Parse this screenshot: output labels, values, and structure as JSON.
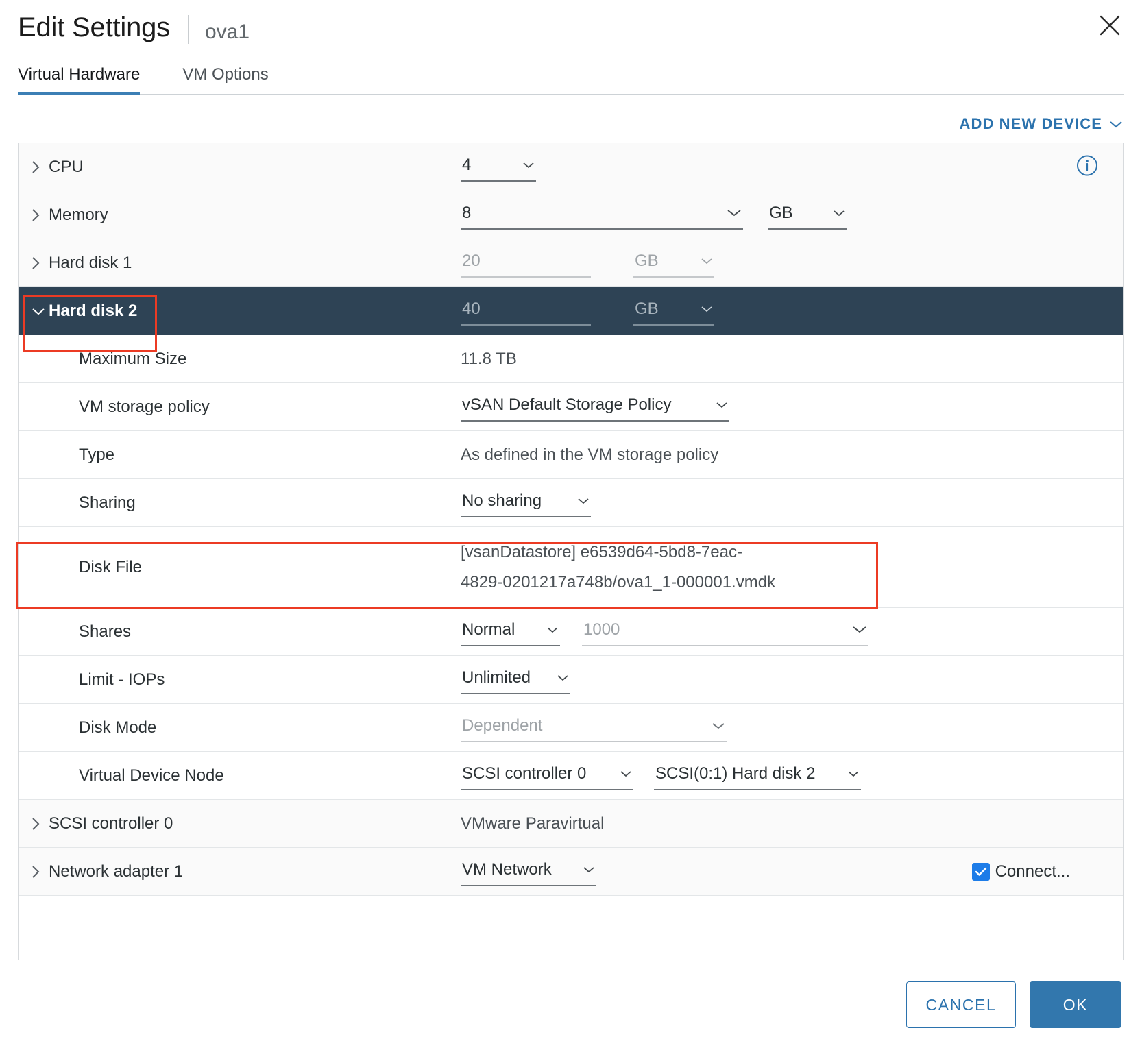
{
  "header": {
    "title": "Edit Settings",
    "vm_name": "ova1",
    "close_icon": "close-icon"
  },
  "tabs": [
    {
      "label": "Virtual Hardware",
      "active": true
    },
    {
      "label": "VM Options",
      "active": false
    }
  ],
  "toolbar": {
    "add_new_device": "ADD NEW DEVICE",
    "caret_icon": "chevron-down-icon"
  },
  "rows": {
    "cpu": {
      "label": "CPU",
      "value": "4",
      "expander": "chevron-right-icon",
      "info_icon": "info-circle-icon"
    },
    "memory": {
      "label": "Memory",
      "value": "8",
      "unit": "GB",
      "expander": "chevron-right-icon"
    },
    "hard_disk_1": {
      "label": "Hard disk 1",
      "value": "20",
      "unit": "GB",
      "expander": "chevron-right-icon"
    },
    "hard_disk_2": {
      "label": "Hard disk 2",
      "value": "40",
      "unit": "GB",
      "expander": "chevron-down-icon"
    },
    "maximum_size": {
      "label": "Maximum Size",
      "value": "11.8 TB"
    },
    "vm_storage_policy": {
      "label": "VM storage policy",
      "value": "vSAN Default Storage Policy"
    },
    "type": {
      "label": "Type",
      "value": "As defined in the VM storage policy"
    },
    "sharing": {
      "label": "Sharing",
      "value": "No sharing"
    },
    "disk_file": {
      "label": "Disk File",
      "value_line1": "[vsanDatastore] e6539d64-5bd8-7eac-",
      "value_line2": "4829-0201217a748b/ova1_1-000001.vmdk"
    },
    "shares": {
      "label": "Shares",
      "value": "Normal",
      "amount": "1000"
    },
    "limit_iops": {
      "label": "Limit - IOPs",
      "value": "Unlimited"
    },
    "disk_mode": {
      "label": "Disk Mode",
      "value": "Dependent"
    },
    "virtual_device_node": {
      "label": "Virtual Device Node",
      "controller": "SCSI controller 0",
      "node": "SCSI(0:1) Hard disk 2"
    },
    "scsi_controller_0": {
      "label": "SCSI controller 0",
      "value": "VMware Paravirtual",
      "expander": "chevron-right-icon"
    },
    "network_adapter_1": {
      "label": "Network adapter 1",
      "value": "VM Network",
      "checkbox_label": "Connect...",
      "checkbox_checked": true,
      "expander": "chevron-right-icon"
    }
  },
  "footer": {
    "cancel": "CANCEL",
    "ok": "OK"
  },
  "colors": {
    "accent": "#2b72ad",
    "selected_row": "#2e4355",
    "annotation": "#ec3b24",
    "primary_button": "#3277ad",
    "checkbox": "#1d7ce8"
  }
}
